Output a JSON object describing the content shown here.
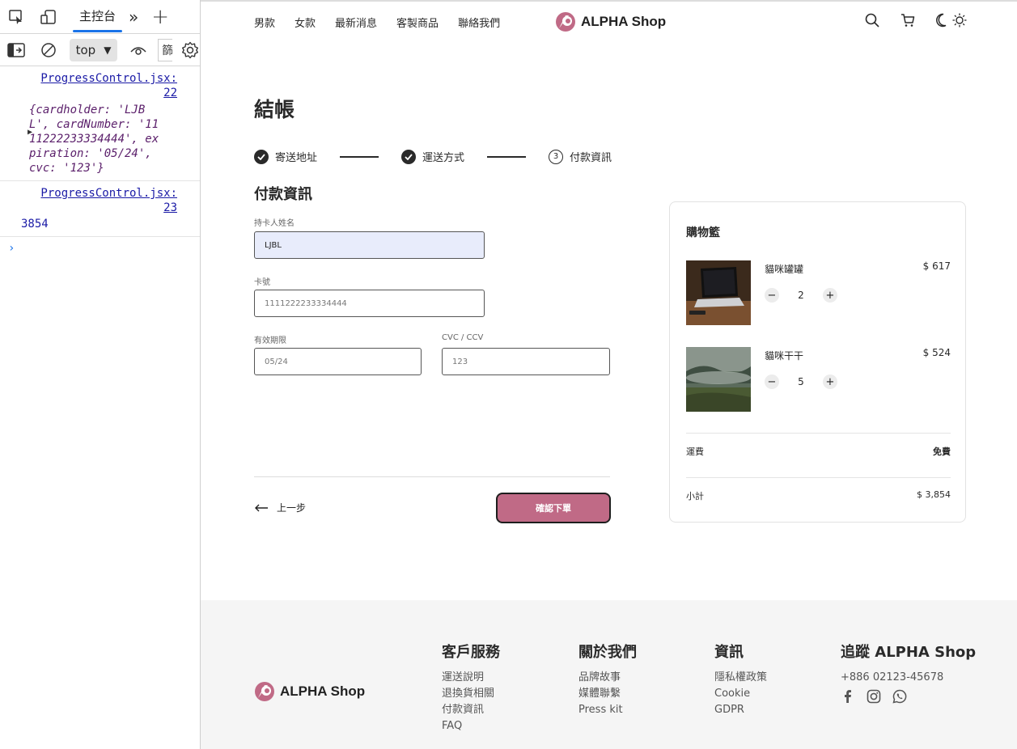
{
  "devtools": {
    "tab_label": "主控台",
    "context": "top",
    "filter_label": "篩",
    "messages": [
      {
        "source_file": "ProgressControl.jsx:",
        "source_line": "22",
        "object_text": "{cardholder: 'LJB\nL', cardNumber: '11\n11222233334444', ex\npiration: '05/24',\ncvc: '123'}"
      },
      {
        "source_file": "ProgressControl.jsx:",
        "source_line": "23",
        "value": "3854"
      }
    ],
    "prompt": "›"
  },
  "nav": {
    "items": [
      "男款",
      "女款",
      "最新消息",
      "客製商品",
      "聯絡我們"
    ],
    "brand": "ALPHA Shop"
  },
  "checkout": {
    "title": "結帳",
    "steps": [
      {
        "label": "寄送地址",
        "state": "done"
      },
      {
        "label": "運送方式",
        "state": "done"
      },
      {
        "label": "付款資訊",
        "state": "current",
        "number": "3"
      }
    ],
    "section_title": "付款資訊",
    "form": {
      "cardholder_label": "持卡人姓名",
      "cardholder_value": "LJBL",
      "card_number_label": "卡號",
      "card_number_value": "1111222233334444",
      "expiry_label": "有效期限",
      "expiry_value": "05/24",
      "cvc_label": "CVC / CCV",
      "cvc_value": "123"
    },
    "back_label": "上一步",
    "confirm_label": "確認下單"
  },
  "cart": {
    "title": "購物籃",
    "items": [
      {
        "name": "貓咪罐罐",
        "price": "$ 617",
        "qty": "2"
      },
      {
        "name": "貓咪干干",
        "price": "$ 524",
        "qty": "5"
      }
    ],
    "shipping_label": "運費",
    "shipping_value": "免費",
    "subtotal_label": "小計",
    "subtotal_value": "$ 3,854"
  },
  "footer": {
    "brand": "ALPHA Shop",
    "columns": [
      {
        "title": "客戶服務",
        "links": [
          "運送說明",
          "退換貨相關",
          "付款資訊",
          "FAQ"
        ]
      },
      {
        "title": "關於我們",
        "links": [
          "品牌故事",
          "媒體聯繫",
          "Press kit"
        ]
      },
      {
        "title": "資訊",
        "links": [
          "隱私權政策",
          "Cookie",
          "GDPR"
        ]
      }
    ],
    "follow_title": "追蹤 ALPHA Shop",
    "phone": "+886 02123-45678"
  },
  "colors": {
    "accent": "#c06a86",
    "devtools_link": "#1a1aa6",
    "devtools_object": "#5a1e6a",
    "input_fill": "#e8ecfb",
    "footer_bg": "#f5f5f5"
  },
  "icons": [
    "inspect-icon",
    "device-icon",
    "more-tabs-icon",
    "plus-icon",
    "sidebar-icon",
    "clear-icon",
    "eye-icon",
    "gear-icon",
    "search-icon",
    "cart-icon",
    "moon-icon",
    "sun-icon",
    "check-icon",
    "arrow-left-icon",
    "minus-icon",
    "facebook-icon",
    "instagram-icon",
    "whatsapp-icon"
  ]
}
